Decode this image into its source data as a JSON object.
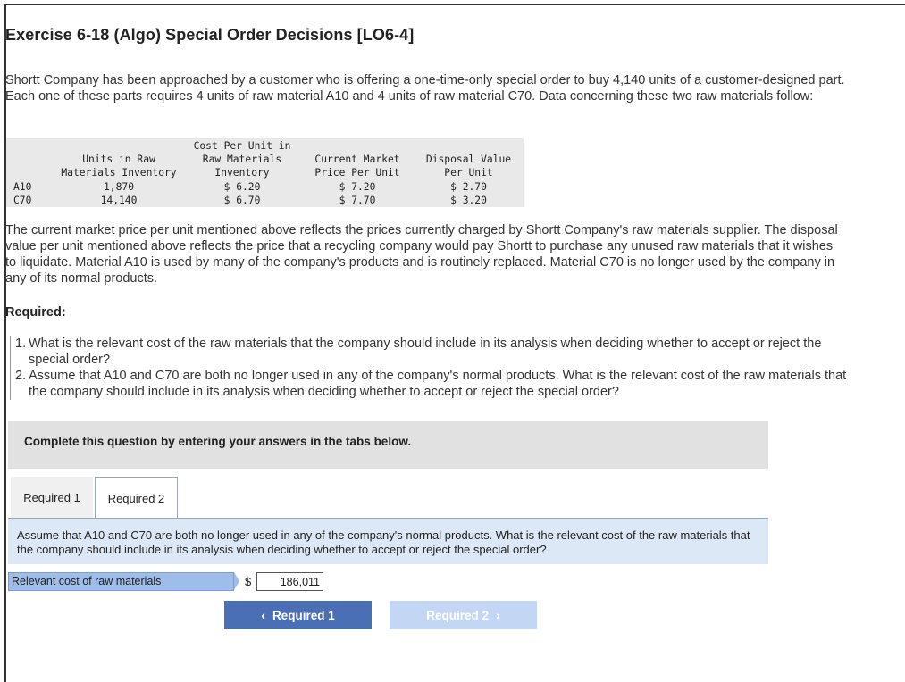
{
  "title": "Exercise 6-18 (Algo) Special Order Decisions [LO6-4]",
  "intro": "Shortt Company has been approached by a customer who is offering a one-time-only special order to buy 4,140 units of a customer-designed part. Each one of these parts requires 4 units of raw material A10 and 4 units of raw material C70. Data concerning these two raw materials follow:",
  "table": {
    "headers": {
      "units": [
        "Units in Raw",
        "Materials Inventory"
      ],
      "cost": [
        "Cost Per Unit in",
        "Raw Materials",
        "Inventory"
      ],
      "market": [
        "Current Market",
        "Price Per Unit"
      ],
      "disposal": [
        "Disposal Value",
        "Per Unit"
      ]
    },
    "rows": [
      {
        "material": "A10",
        "units": "1,870",
        "cost": "$ 6.20",
        "market": "$ 7.20",
        "disposal": "$ 2.70"
      },
      {
        "material": "C70",
        "units": "14,140",
        "cost": "$ 6.70",
        "market": "$ 7.70",
        "disposal": "$ 3.20"
      }
    ]
  },
  "explanation": "The current market price per unit mentioned above reflects the prices currently charged by Shortt Company's raw materials supplier. The disposal value per unit mentioned above reflects the price that a recycling company would pay Shortt to purchase any unused raw materials that it wishes to liquidate. Material A10 is used by many of the company's products and is routinely replaced. Material C70 is no longer used by the company in any of its normal products.",
  "required_label": "Required:",
  "requirements": [
    {
      "num": "1.",
      "text": "What is the relevant cost of the raw materials that the company should include in its analysis when deciding whether to accept or reject the special order?"
    },
    {
      "num": "2.",
      "text": "Assume that A10 and C70 are both no longer used in any of the company's normal products. What is the relevant cost of the raw materials that the company should include in its analysis when deciding whether to accept or reject the special order?"
    }
  ],
  "instruction": "Complete this question by entering your answers in the tabs below.",
  "tabs": [
    "Required 1",
    "Required 2"
  ],
  "question": "Assume that A10 and C70 are both no longer used in any of the company's normal products. What is the relevant cost of the raw materials that the company should include in its analysis when deciding whether to accept or reject the special order?",
  "answer": {
    "label": "Relevant cost of raw materials",
    "currency": "$",
    "value": "186,011"
  },
  "nav": {
    "prev": "Required 1",
    "next": "Required 2"
  },
  "colors": {
    "prev_button": "#4b6fb5",
    "next_button": "#c3d7f4",
    "question_bg": "#dde8f6",
    "label_bg": "#9fbdeb"
  }
}
